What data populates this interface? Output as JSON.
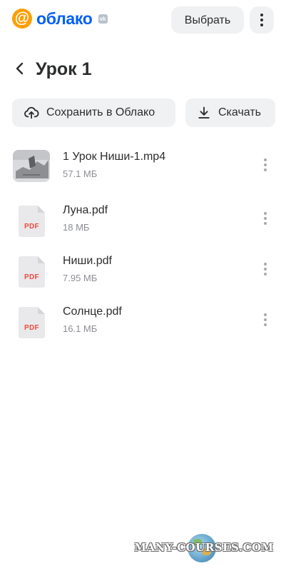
{
  "header": {
    "logo_symbol": "@",
    "logo_text": "облако",
    "vk_badge": "vk",
    "select_label": "Выбрать",
    "more_icon": "more-vertical-icon"
  },
  "title_row": {
    "back_icon": "chevron-left-icon",
    "title": "Урок 1"
  },
  "actions": {
    "save_label": "Сохранить в Облако",
    "save_icon": "cloud-upload-icon",
    "download_label": "Скачать",
    "download_icon": "download-icon"
  },
  "files": [
    {
      "name": "1 Урок Ниши-1.mp4",
      "size": "57.1 МБ",
      "type": "video"
    },
    {
      "name": "Луна.pdf",
      "size": "18 МБ",
      "type": "pdf",
      "badge": "PDF"
    },
    {
      "name": "Ниши.pdf",
      "size": "7.95 МБ",
      "type": "pdf",
      "badge": "PDF"
    },
    {
      "name": "Солнце.pdf",
      "size": "16.1 МБ",
      "type": "pdf",
      "badge": "PDF"
    }
  ],
  "watermark": {
    "text": "MANY-COURSES.COM"
  },
  "colors": {
    "brand_orange": "#ff9e00",
    "brand_blue": "#005ff9",
    "pdf_red": "#ef4b3f",
    "button_bg": "#f0f1f3"
  }
}
